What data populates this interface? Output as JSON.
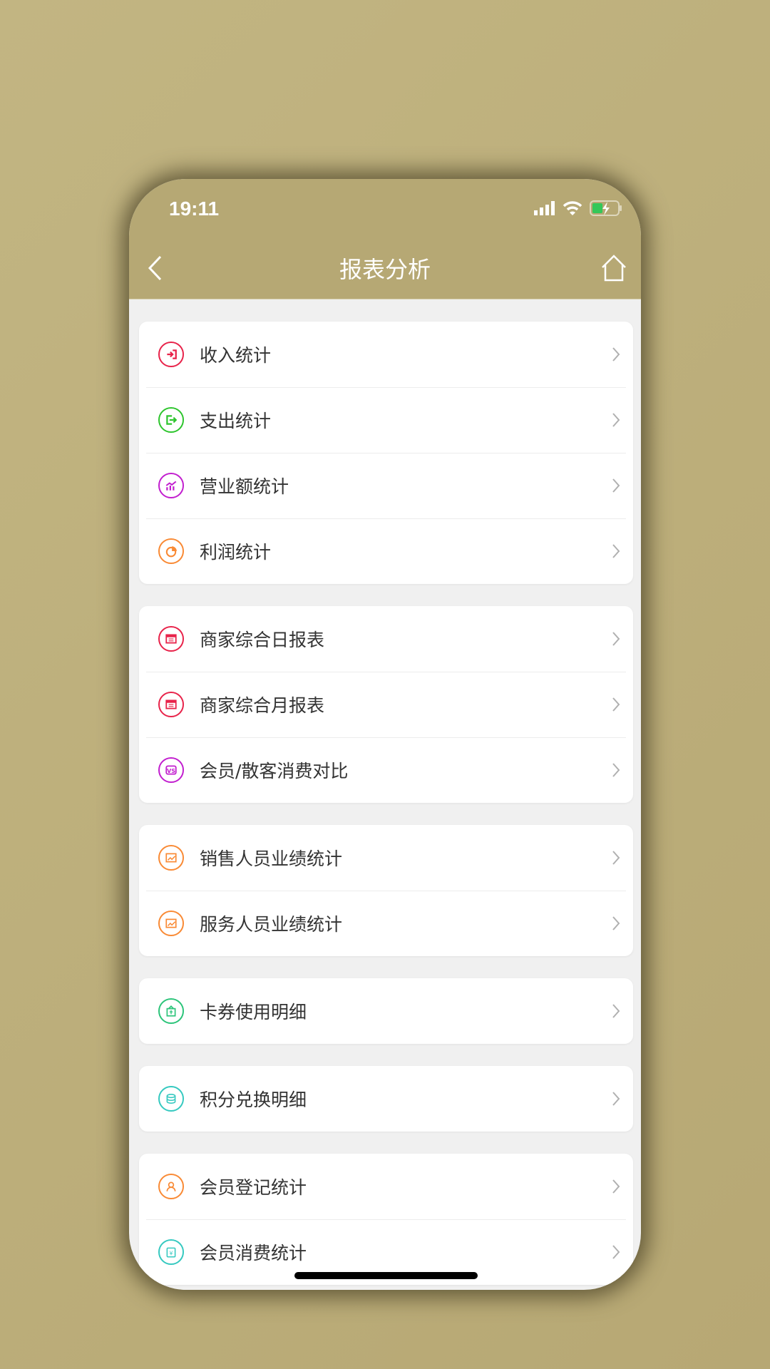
{
  "status_bar": {
    "time": "19:11",
    "battery_color": "#34c759"
  },
  "header": {
    "title": "报表分析",
    "back_icon": "chevron-left-icon",
    "home_icon": "home-icon",
    "background": "#b6a874"
  },
  "groups": [
    {
      "items": [
        {
          "label": "收入统计",
          "icon": "income-icon",
          "color": "#e8234a"
        },
        {
          "label": "支出统计",
          "icon": "expense-icon",
          "color": "#2ec52e"
        },
        {
          "label": "营业额统计",
          "icon": "chart-icon",
          "color": "#c21fcf"
        },
        {
          "label": "利润统计",
          "icon": "pie-chart-icon",
          "color": "#f98a35"
        }
      ]
    },
    {
      "items": [
        {
          "label": "商家综合日报表",
          "icon": "report-icon",
          "color": "#e8234a"
        },
        {
          "label": "商家综合月报表",
          "icon": "report-icon",
          "color": "#e8234a"
        },
        {
          "label": "会员/散客消费对比",
          "icon": "vs-icon",
          "color": "#c21fcf"
        }
      ]
    },
    {
      "items": [
        {
          "label": "销售人员业绩统计",
          "icon": "image-chart-icon",
          "color": "#f98a35"
        },
        {
          "label": "服务人员业绩统计",
          "icon": "image-chart-icon",
          "color": "#f98a35"
        }
      ]
    },
    {
      "items": [
        {
          "label": "卡券使用明细",
          "icon": "coupon-icon",
          "color": "#2cc47a"
        }
      ]
    },
    {
      "items": [
        {
          "label": "积分兑换明细",
          "icon": "coins-icon",
          "color": "#36c9c0"
        }
      ]
    },
    {
      "items": [
        {
          "label": "会员登记统计",
          "icon": "user-icon",
          "color": "#f98a35"
        },
        {
          "label": "会员消费统计",
          "icon": "yen-clipboard-icon",
          "color": "#36c9c0"
        }
      ]
    }
  ]
}
